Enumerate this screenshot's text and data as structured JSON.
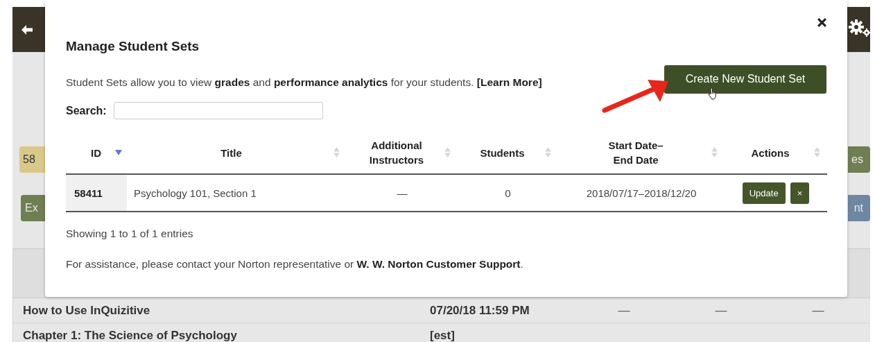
{
  "background_page": {
    "badge": "58",
    "left_button": "Ex",
    "right_buttons": [
      {
        "label": "es",
        "kind": "green"
      },
      {
        "label": "nt",
        "kind": "blue"
      }
    ],
    "table": {
      "rows": [
        {
          "title": "How to Use InQuizitive",
          "column_2": "07/20/18 11:59 PM",
          "column_3": "—",
          "column_4": "—",
          "column_5": "—"
        },
        {
          "title": "Chapter 1: The Science of Psychology",
          "column_2": "[est]"
        }
      ]
    }
  },
  "dialog": {
    "title": "Manage Student Sets",
    "description": "Student Sets allow you to view **grades** and **performance analytics** for your students.",
    "learn_more": "[Learn More]",
    "create_button": "Create New Student Set",
    "search": {
      "label": "Search:"
    },
    "table": {
      "columns": [
        {
          "label": "ID",
          "sorted_descending": true
        },
        {
          "label": "Title",
          "sorted_descending": false
        },
        {
          "label": "Additional Instructors",
          "sorted_descending": false
        },
        {
          "label": "Students",
          "sorted_descending": false
        },
        {
          "label": "Start Date–End Date",
          "sorted_descending": false
        },
        {
          "label": "Actions",
          "sorted_descending": false
        }
      ],
      "rows": [
        {
          "id": "58411",
          "title": "Psychology 101, Section 1",
          "additional_instructors": "—",
          "students": "0",
          "dates": "2018/07/17–2018/12/20",
          "actions": [
            "Update",
            "×"
          ]
        }
      ]
    },
    "entries_info": "Showing 1 to 1 of 1 entries",
    "footer": "For assistance, please contact your Norton representative or **W. W. Norton Customer Support**."
  }
}
